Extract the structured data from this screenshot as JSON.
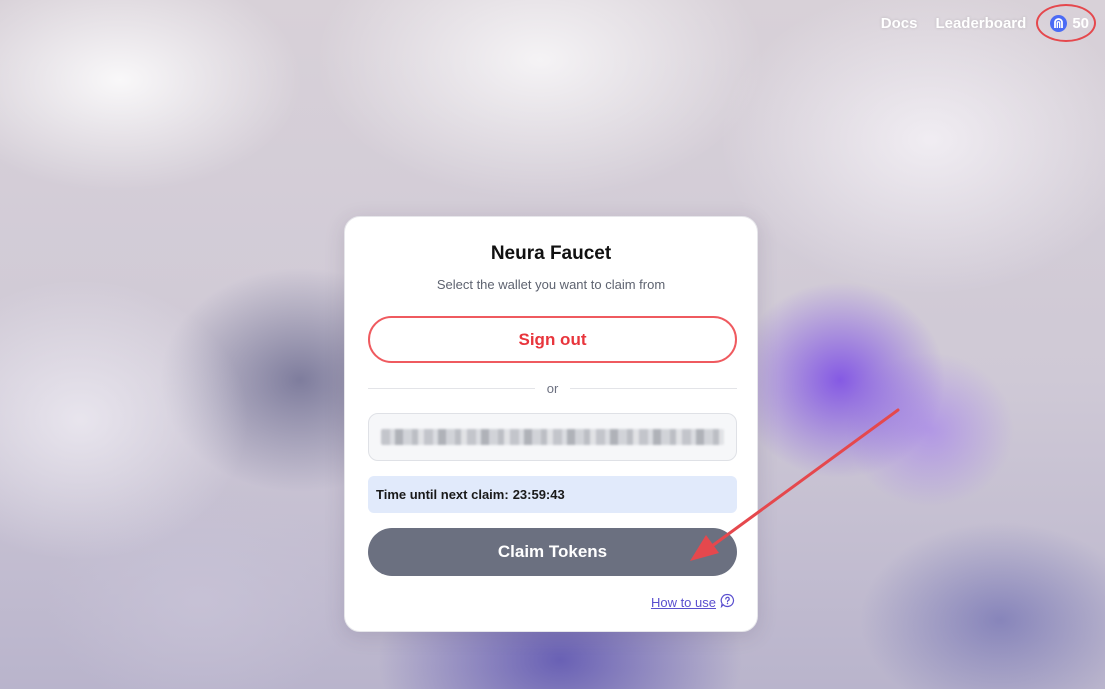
{
  "nav": {
    "docs_label": "Docs",
    "leaderboard_label": "Leaderboard",
    "points_value": "50"
  },
  "card": {
    "title": "Neura Faucet",
    "subtitle": "Select the wallet you want to claim from",
    "sign_out_label": "Sign out",
    "divider_label": "or",
    "wallet_address": "",
    "timer_label": "Time until next claim:",
    "timer_value": "23:59:43",
    "claim_label": "Claim Tokens",
    "how_to_label": "How to use"
  },
  "colors": {
    "accent_red": "#e8353c",
    "annotation_red": "#e5484d",
    "claim_button": "#6b7080",
    "link_purple": "#5a4fcf",
    "timer_bg": "#e1eafb",
    "coin_blue": "#4b6bf5"
  },
  "icons": {
    "points": "neura-coin-icon",
    "help": "question-bubble-icon"
  }
}
